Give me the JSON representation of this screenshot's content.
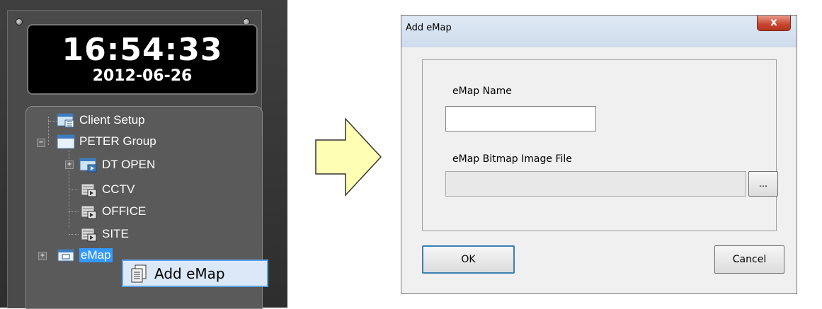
{
  "clock": {
    "time": "16:54:33",
    "date": "2012-06-26"
  },
  "tree": {
    "items": [
      {
        "label": "Client Setup",
        "icon": "client-setup-icon"
      },
      {
        "label": "PETER Group",
        "icon": "folder-icon",
        "expander": "−"
      },
      {
        "label": "DT OPEN",
        "icon": "site-icon",
        "expander": "+"
      },
      {
        "label": "CCTV",
        "icon": "dvr-icon"
      },
      {
        "label": "OFFICE",
        "icon": "dvr-icon"
      },
      {
        "label": "SITE",
        "icon": "dvr-icon"
      },
      {
        "label": "eMap",
        "icon": "emap-icon",
        "expander": "+"
      }
    ]
  },
  "context_menu": {
    "item_label": "Add eMap",
    "icon": "add-emap-icon"
  },
  "dialog": {
    "title": "Add eMap",
    "close_label": "x",
    "name_label": "eMap Name",
    "name_value": "",
    "file_label": "eMap Bitmap Image File",
    "file_value": "",
    "browse_label": "...",
    "ok_label": "OK",
    "cancel_label": "Cancel"
  },
  "colors": {
    "selection": "#3399ff",
    "arrow_fill": "#ffffb3",
    "menu_highlight": "#dbe8f7"
  }
}
